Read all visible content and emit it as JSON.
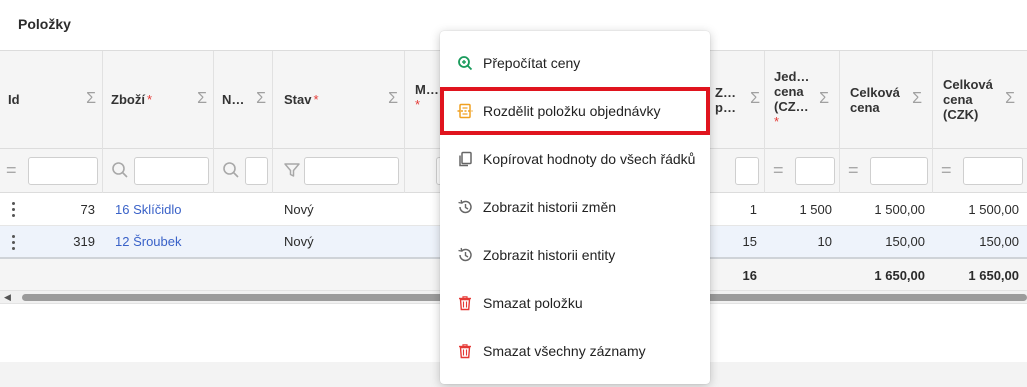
{
  "panel": {
    "title": "Položky"
  },
  "columns": [
    {
      "key": "id",
      "label": "Id",
      "required": false
    },
    {
      "key": "zbozi",
      "label": "Zboží",
      "required": true
    },
    {
      "key": "n",
      "label": "N…",
      "required": false
    },
    {
      "key": "stav",
      "label": "Stav",
      "required": true
    },
    {
      "key": "m",
      "label": "M…",
      "required": true
    },
    {
      "key": "z",
      "label": "Z… p…",
      "required": false
    },
    {
      "key": "jed",
      "label": "Jed… cena (CZ…",
      "required": true
    },
    {
      "key": "celkova",
      "label": "Celková cena",
      "required": false
    },
    {
      "key": "celkova_czk",
      "label": "Celková cena (CZK)",
      "required": false
    }
  ],
  "sigma": "Σ",
  "required_mark": "*",
  "rows": [
    {
      "id": "73",
      "zbozi": "16 Sklíčidlo",
      "stav": "Nový",
      "z": "1",
      "jed": "1 500",
      "celkova": "1 500,00",
      "celkova_czk": "1 500,00"
    },
    {
      "id": "319",
      "zbozi": "12 Šroubek",
      "stav": "Nový",
      "z": "15",
      "jed": "10",
      "celkova": "150,00",
      "celkova_czk": "150,00"
    }
  ],
  "totals": {
    "z": "16",
    "celkova": "1 650,00",
    "celkova_czk": "1 650,00"
  },
  "context_menu": {
    "items": [
      {
        "label": "Přepočítat ceny",
        "icon": "recalculate-icon",
        "color": "#1a9b5c"
      },
      {
        "label": "Rozdělit položku objednávky",
        "icon": "split-icon",
        "color": "#f0a020",
        "highlighted": true
      },
      {
        "label": "Kopírovat hodnoty do všech řádků",
        "icon": "copy-icon",
        "color": "#666666"
      },
      {
        "label": "Zobrazit historii změn",
        "icon": "history-icon",
        "color": "#666666"
      },
      {
        "label": "Zobrazit historii entity",
        "icon": "history-icon",
        "color": "#666666"
      },
      {
        "label": "Smazat položku",
        "icon": "trash-icon",
        "color": "#e53935"
      },
      {
        "label": "Smazat všechny záznamy",
        "icon": "trash-icon",
        "color": "#e53935"
      }
    ]
  },
  "colors": {
    "link": "#3a62c8",
    "required": "#e53935",
    "highlight": "#e0141e"
  }
}
